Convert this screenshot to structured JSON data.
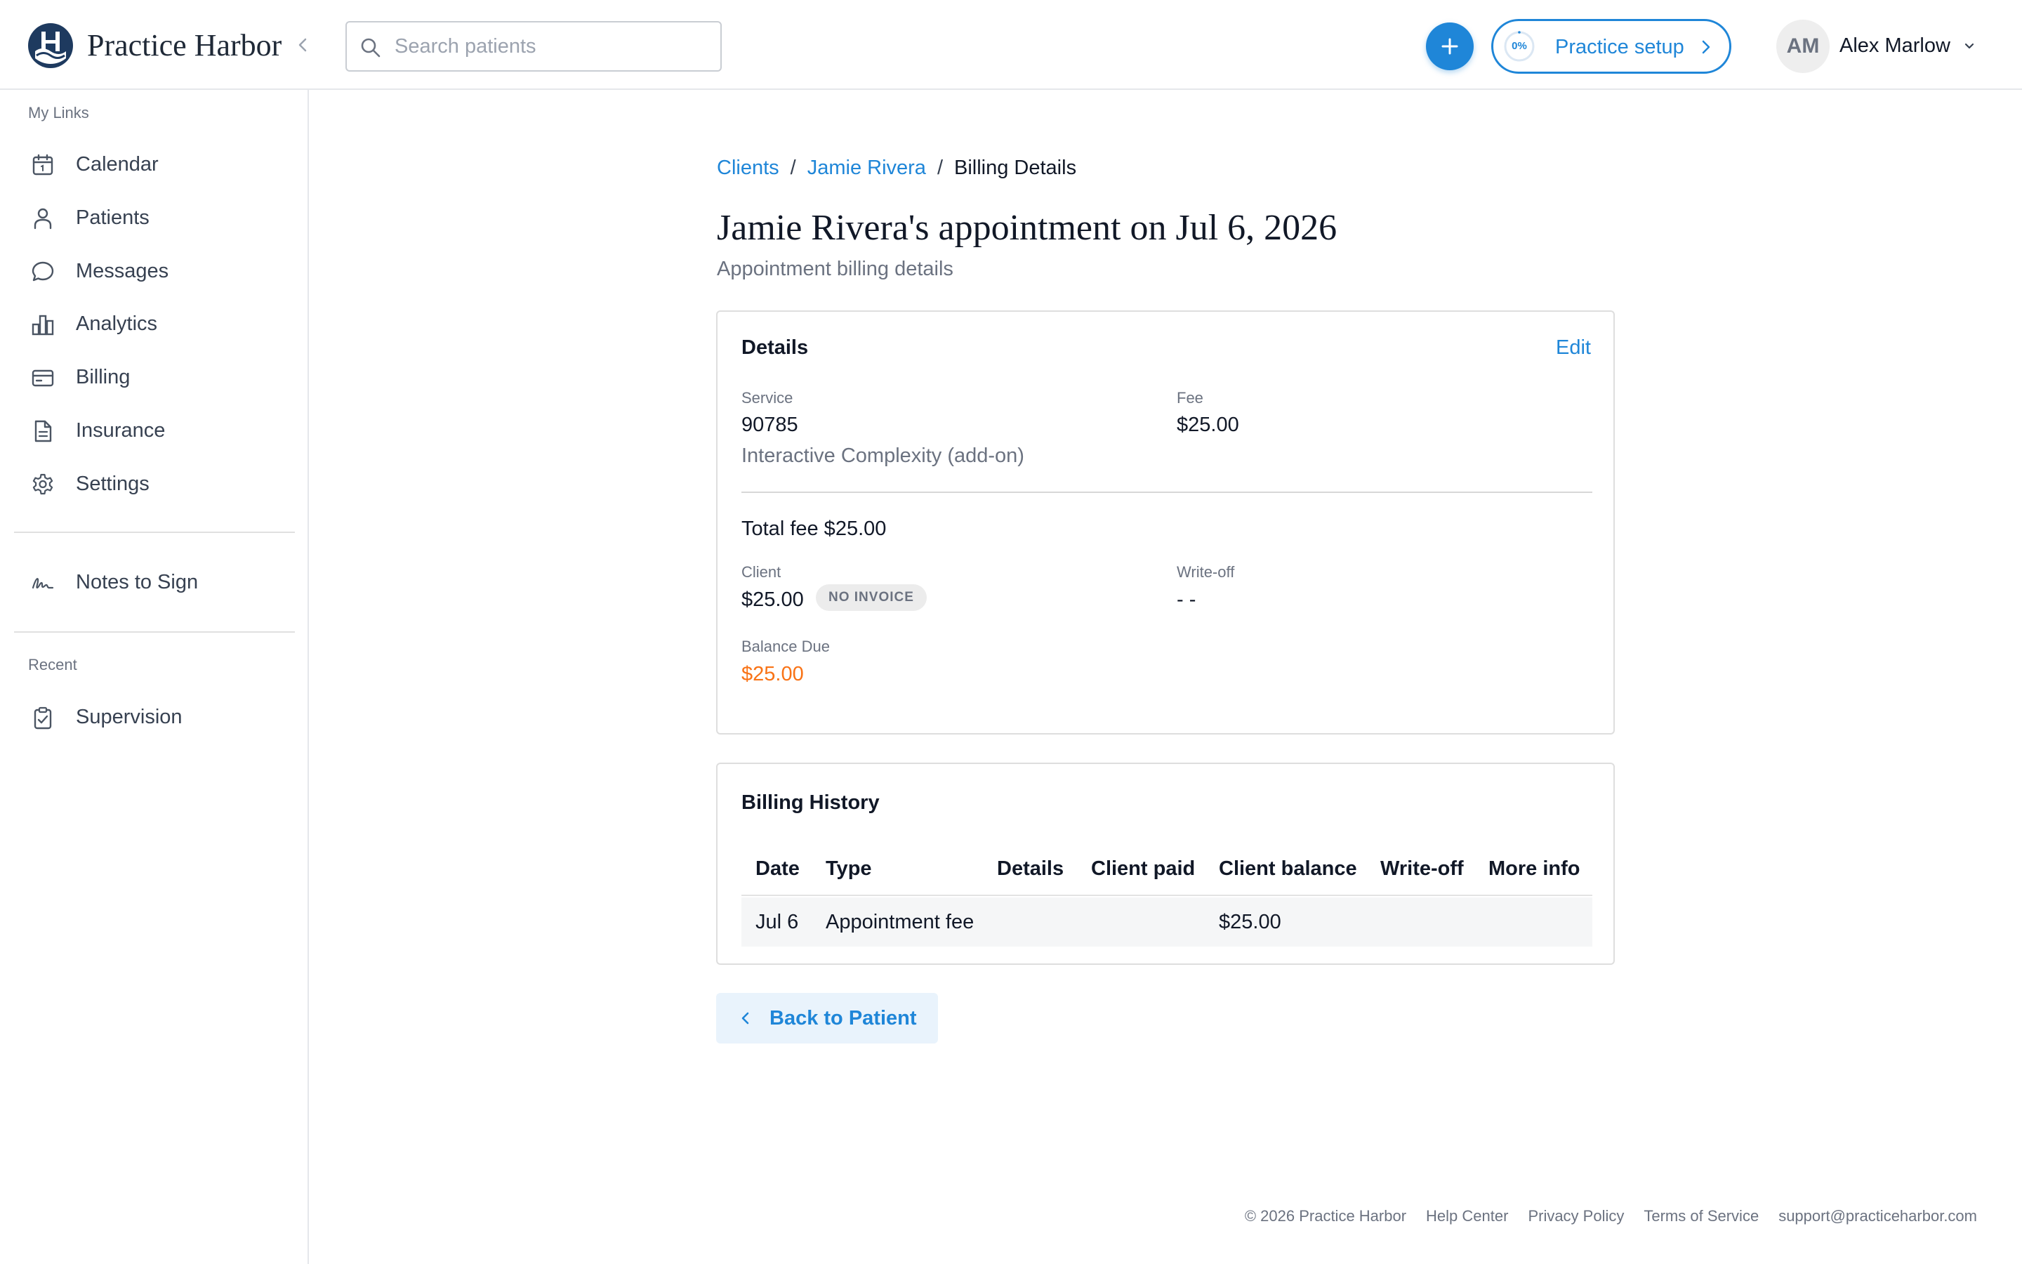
{
  "app": {
    "brand": "Practice Harbor"
  },
  "header": {
    "search_placeholder": "Search patients",
    "setup": {
      "label": "Practice setup",
      "progress_text": "0%",
      "progress_value": 0
    },
    "user": {
      "initials": "AM",
      "name": "Alex Marlow"
    }
  },
  "sidebar": {
    "my_links_label": "My Links",
    "items": [
      {
        "label": "Calendar",
        "icon": "calendar-icon"
      },
      {
        "label": "Patients",
        "icon": "user-icon"
      },
      {
        "label": "Messages",
        "icon": "chat-bubble-icon"
      },
      {
        "label": "Analytics",
        "icon": "bar-chart-icon"
      },
      {
        "label": "Billing",
        "icon": "credit-card-icon"
      },
      {
        "label": "Insurance",
        "icon": "document-icon"
      },
      {
        "label": "Settings",
        "icon": "gear-icon"
      }
    ],
    "notes_to_sign": {
      "label": "Notes to Sign",
      "icon": "signature-icon"
    },
    "recent_label": "Recent",
    "recent_items": [
      {
        "label": "Supervision",
        "icon": "clipboard-check-icon"
      }
    ]
  },
  "breadcrumb": {
    "items": [
      "Clients",
      "Jamie Rivera"
    ],
    "separator": "/",
    "current": "Billing Details"
  },
  "page": {
    "title": "Jamie Rivera's appointment on Jul 6, 2026",
    "subtitle": "Appointment billing details"
  },
  "details_card": {
    "title": "Details",
    "edit_label": "Edit",
    "service_label": "Service",
    "service_code": "90785",
    "service_description": "Interactive Complexity (add-on)",
    "fee_label": "Fee",
    "fee_value": "$25.00",
    "total_fee": "Total fee $25.00",
    "client_label": "Client",
    "client_value": "$25.00",
    "client_badge": "NO INVOICE",
    "writeoff_label": "Write-off",
    "writeoff_value": "- -",
    "balance_label": "Balance Due",
    "balance_value": "$25.00"
  },
  "billing_history": {
    "title": "Billing History",
    "columns": [
      "Date",
      "Type",
      "Details",
      "Client paid",
      "Client balance",
      "Write-off",
      "More info"
    ],
    "rows": [
      [
        "Jul 6",
        "Appointment fee",
        "",
        "",
        "$25.00",
        "",
        ""
      ]
    ]
  },
  "back_button": {
    "label": "Back to Patient"
  },
  "footer": {
    "copyright": "© 2026 Practice Harbor",
    "links": [
      "Help Center",
      "Privacy Policy",
      "Terms of Service",
      "support@practiceharbor.com"
    ]
  },
  "colors": {
    "accent": "#1f86d8",
    "balance_due": "#f97316",
    "text_primary": "#111827",
    "text_muted": "#6b7280"
  }
}
